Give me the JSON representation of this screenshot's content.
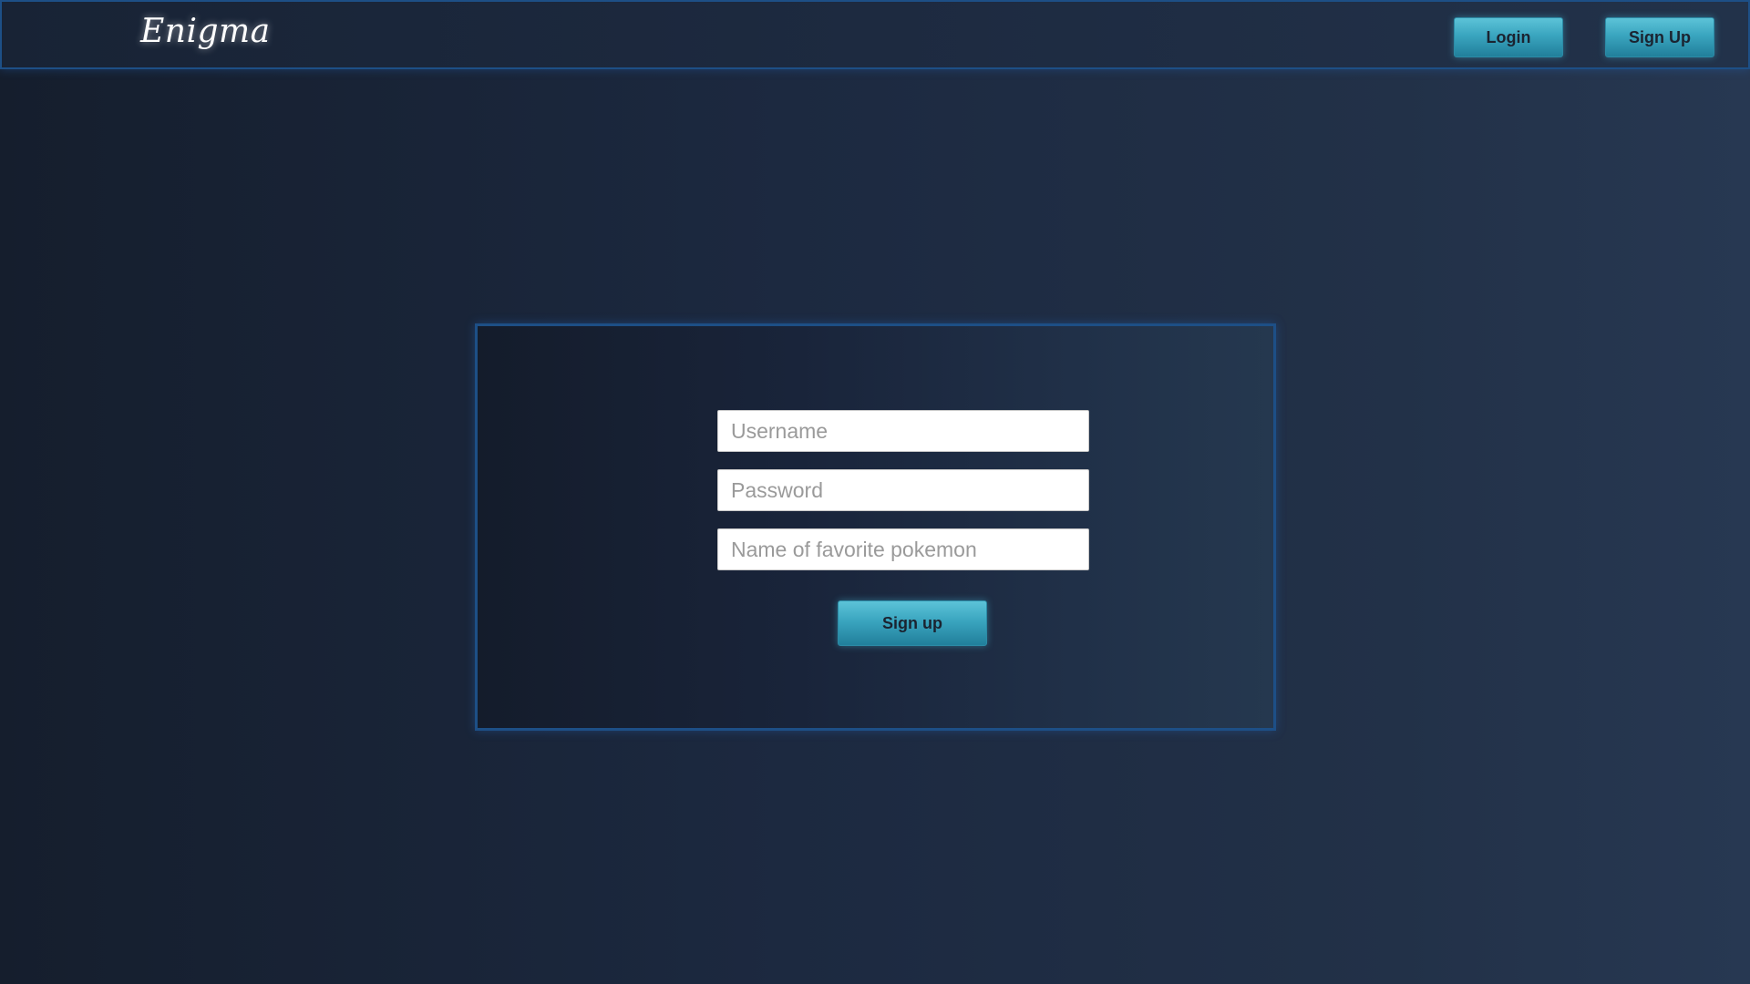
{
  "header": {
    "brand": "Enigma",
    "login_label": "Login",
    "signup_label": "Sign Up"
  },
  "form": {
    "username": {
      "placeholder": "Username",
      "value": ""
    },
    "password": {
      "placeholder": "Password",
      "value": ""
    },
    "pokemon": {
      "placeholder": "Name of favorite pokemon",
      "value": ""
    },
    "submit_label": "Sign up"
  },
  "colors": {
    "accent": "#3aa5bf",
    "border_glow": "#1d4f86",
    "background": "#1c2940"
  }
}
